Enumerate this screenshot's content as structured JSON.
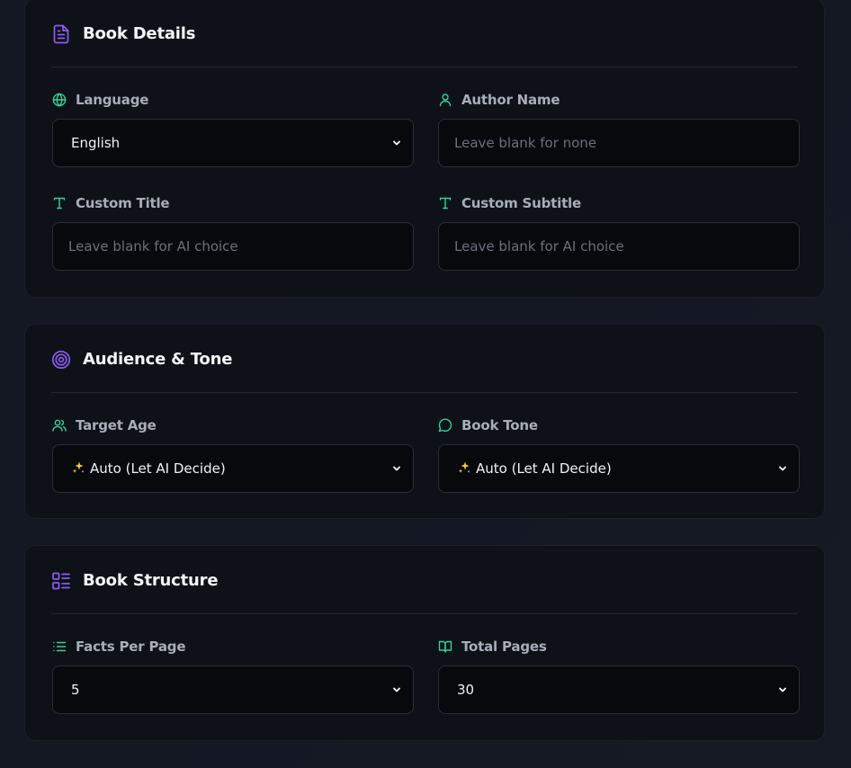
{
  "sections": {
    "book_details": {
      "title": "Book Details",
      "icon": "document-icon",
      "fields": {
        "language": {
          "label": "Language",
          "icon": "globe-icon",
          "value": "English",
          "type": "select"
        },
        "author_name": {
          "label": "Author Name",
          "icon": "user-icon",
          "placeholder": "Leave blank for none",
          "type": "input"
        },
        "custom_title": {
          "label": "Custom Title",
          "icon": "type-icon",
          "placeholder": "Leave blank for AI choice",
          "type": "input"
        },
        "custom_subtitle": {
          "label": "Custom Subtitle",
          "icon": "type-icon",
          "placeholder": "Leave blank for AI choice",
          "type": "input"
        }
      }
    },
    "audience_tone": {
      "title": "Audience & Tone",
      "icon": "target-icon",
      "fields": {
        "target_age": {
          "label": "Target Age",
          "icon": "users-icon",
          "value": "Auto (Let AI Decide)",
          "value_icon": "sparkles-icon",
          "type": "select"
        },
        "book_tone": {
          "label": "Book Tone",
          "icon": "message-circle-icon",
          "value": "Auto (Let AI Decide)",
          "value_icon": "sparkles-icon",
          "type": "select"
        }
      }
    },
    "book_structure": {
      "title": "Book Structure",
      "icon": "layout-list-icon",
      "fields": {
        "facts_per_page": {
          "label": "Facts Per Page",
          "icon": "list-icon",
          "value": "5",
          "type": "select"
        },
        "total_pages": {
          "label": "Total Pages",
          "icon": "book-open-icon",
          "value": "30",
          "type": "select"
        }
      }
    }
  },
  "colors": {
    "accent_purple": "#8b5cf6",
    "accent_green": "#34d399",
    "background": "#131722",
    "card": "#0e1117",
    "input": "#07090d",
    "border": "#2a2e38",
    "label": "#a7adba",
    "text": "#f1f2f5",
    "placeholder": "#6a707c"
  }
}
